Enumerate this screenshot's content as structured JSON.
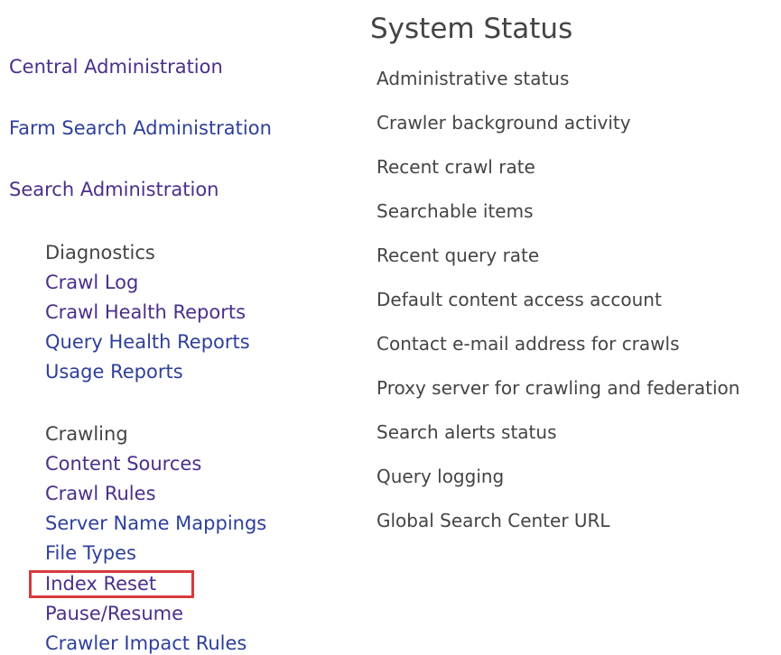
{
  "nav": {
    "central_admin": "Central Administration",
    "farm_search_admin": "Farm Search Administration",
    "search_admin": "Search Administration",
    "diagnostics": {
      "heading": "Diagnostics",
      "items": [
        "Crawl Log",
        "Crawl Health Reports",
        "Query Health Reports",
        "Usage Reports"
      ]
    },
    "crawling": {
      "heading": "Crawling",
      "items": [
        "Content Sources",
        "Crawl Rules",
        "Server Name Mappings",
        "File Types",
        "Index Reset",
        "Pause/Resume",
        "Crawler Impact Rules"
      ]
    },
    "highlight_color": "#d93a3e"
  },
  "system_status": {
    "title": "System Status",
    "items": [
      "Administrative status",
      "Crawler background activity",
      "Recent crawl rate",
      "Searchable items",
      "Recent query rate",
      "Default content access account",
      "Contact e-mail address for crawls",
      "Proxy server for crawling and federation",
      "Search alerts status",
      "Query logging",
      "Global Search Center URL"
    ]
  }
}
